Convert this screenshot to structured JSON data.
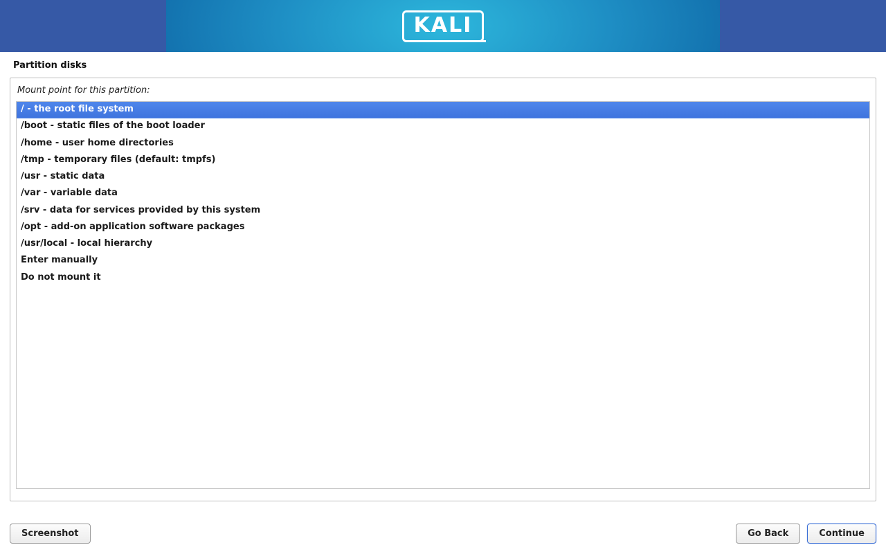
{
  "banner": {
    "logo_text": "KALI"
  },
  "page": {
    "title": "Partition disks",
    "prompt": "Mount point for this partition:"
  },
  "options": [
    "/ - the root file system",
    "/boot - static files of the boot loader",
    "/home - user home directories",
    "/tmp - temporary files (default: tmpfs)",
    "/usr - static data",
    "/var - variable data",
    "/srv - data for services provided by this system",
    "/opt - add-on application software packages",
    "/usr/local - local hierarchy",
    "Enter manually",
    "Do not mount it"
  ],
  "selected_index": 0,
  "buttons": {
    "screenshot": "Screenshot",
    "go_back": "Go Back",
    "continue": "Continue"
  }
}
